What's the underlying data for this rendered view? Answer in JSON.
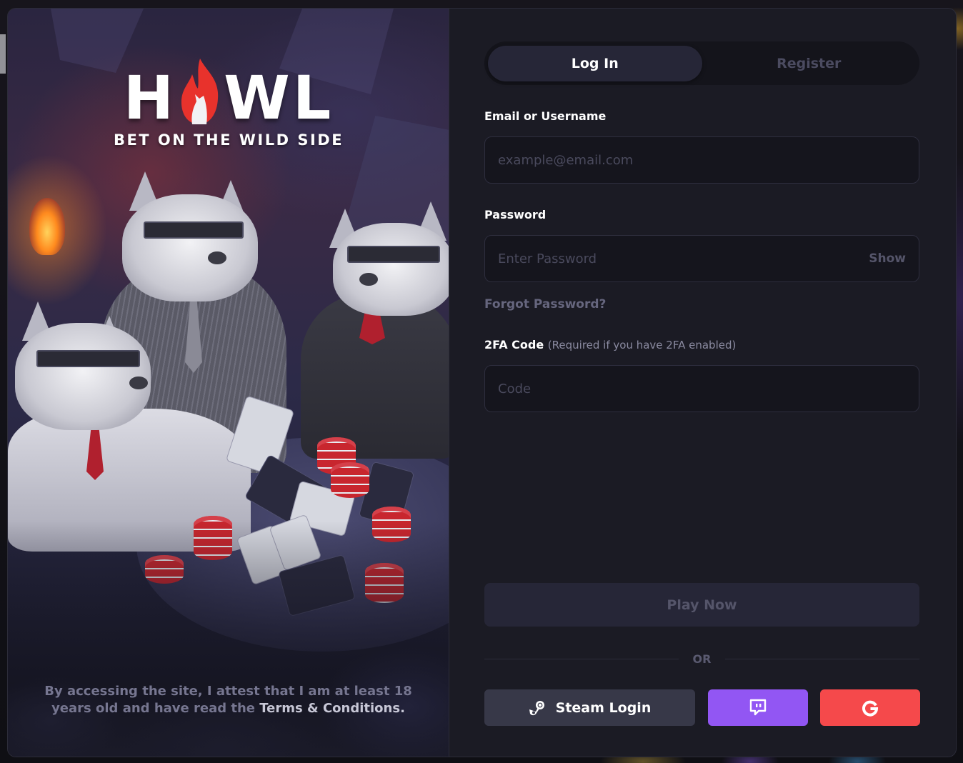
{
  "brand": {
    "logo_left": "H",
    "logo_right": "WL",
    "tagline": "BET ON THE WILD SIDE",
    "accent_color": "#e8322c"
  },
  "disclaimer": {
    "text": "By accessing the site, I attest that I am at least 18 years old and have read the ",
    "terms_link": "Terms & Conditions."
  },
  "tabs": [
    {
      "label": "Log In",
      "active": true
    },
    {
      "label": "Register",
      "active": false
    }
  ],
  "form": {
    "email": {
      "label": "Email or Username",
      "placeholder": "example@email.com",
      "value": ""
    },
    "password": {
      "label": "Password",
      "placeholder": "Enter Password",
      "value": "",
      "toggle_label": "Show"
    },
    "forgot_password": "Forgot Password?",
    "twofa": {
      "label": "2FA Code",
      "hint": "(Required if you have 2FA enabled)",
      "placeholder": "Code",
      "value": ""
    },
    "submit_label": "Play Now",
    "divider_label": "OR"
  },
  "social": {
    "steam": {
      "label": "Steam Login",
      "icon": "steam-icon",
      "color": "#373848"
    },
    "twitch": {
      "icon": "twitch-icon",
      "color": "#9256f3"
    },
    "google": {
      "icon": "google-icon",
      "color": "#f5494b"
    }
  }
}
